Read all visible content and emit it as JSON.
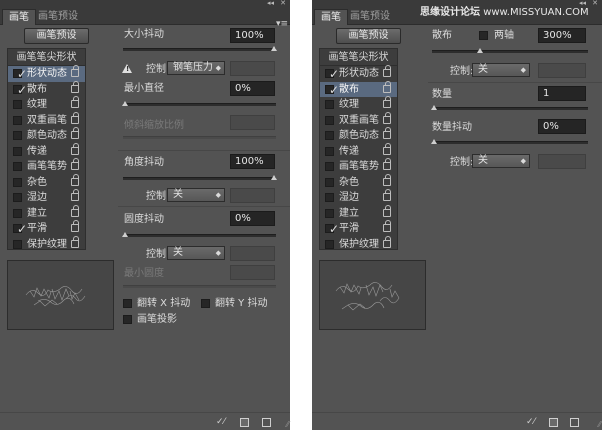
{
  "panel_common": {
    "tabs": [
      "画笔",
      "画笔预设"
    ],
    "collapse_glyph": "◂◂",
    "close_glyph": "✕",
    "panel_menu_glyph": "▾≡",
    "preset_button": "画笔预设",
    "list_header": "画笔笔尖形状",
    "list_items": [
      {
        "label": "形状动态",
        "checked": true
      },
      {
        "label": "散布",
        "checked": true
      },
      {
        "label": "纹理",
        "checked": false
      },
      {
        "label": "双重画笔",
        "checked": false
      },
      {
        "label": "颜色动态",
        "checked": false
      },
      {
        "label": "传递",
        "checked": false
      },
      {
        "label": "画笔笔势",
        "checked": false
      },
      {
        "label": "杂色",
        "checked": false
      },
      {
        "label": "湿边",
        "checked": false
      },
      {
        "label": "建立",
        "checked": false
      },
      {
        "label": "平滑",
        "checked": true
      },
      {
        "label": "保护纹理",
        "checked": false
      }
    ],
    "check_glyph": "✓",
    "icons": [
      "lock-icon",
      "toggle-brush-icon",
      "create-brush-icon",
      "new-preset-icon",
      "trash-icon",
      "warning-icon"
    ]
  },
  "left_panel": {
    "selected_item": "形状动态",
    "size_jitter_label": "大小抖动",
    "size_jitter_value": "100%",
    "size_jitter_fraction": 1.0,
    "control_label": "控制:",
    "control1_value": "钢笔压力",
    "min_diameter_label": "最小直径",
    "min_diameter_value": "0%",
    "min_diameter_fraction": 0.0,
    "tilt_scale_label": "倾斜缩放比例",
    "angle_jitter_label": "角度抖动",
    "angle_jitter_value": "100%",
    "angle_jitter_fraction": 1.0,
    "control2_value": "关",
    "roundness_jitter_label": "圆度抖动",
    "roundness_jitter_value": "0%",
    "roundness_jitter_fraction": 0.0,
    "control3_value": "关",
    "min_roundness_label": "最小圆度",
    "flip_x_label": "翻转 X 抖动",
    "flip_y_label": "翻转 Y 抖动",
    "brush_projection_label": "画笔投影"
  },
  "right_panel": {
    "selected_item": "散布",
    "scatter_label": "散布",
    "both_axes_label": "两轴",
    "scatter_value": "300%",
    "scatter_fraction": 0.3,
    "control_label": "控制:",
    "control1_value": "关",
    "count_label": "数量",
    "count_value": "1",
    "count_fraction": 0.0,
    "count_jitter_label": "数量抖动",
    "count_jitter_value": "0%",
    "count_jitter_fraction": 0.0,
    "control2_value": "关"
  },
  "watermark": {
    "prefix": "思缘设计论坛",
    "suffix": "www.MISSYUAN.COM"
  }
}
